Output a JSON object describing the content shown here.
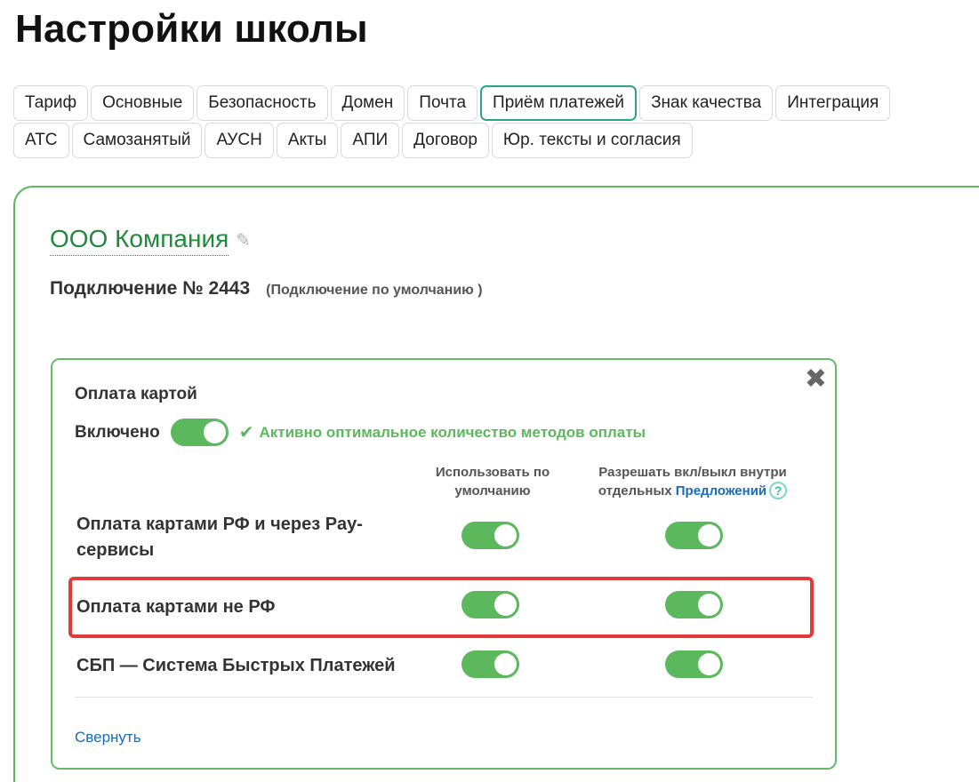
{
  "page_title": "Настройки школы",
  "tabs_row1": [
    "Тариф",
    "Основные",
    "Безопасность",
    "Домен",
    "Почта",
    "Приём платежей",
    "Знак качества",
    "Интеграция"
  ],
  "tabs_row2": [
    "АТС",
    "Самозанятый",
    "АУСН",
    "Акты",
    "АПИ",
    "Договор",
    "Юр. тексты и согласия"
  ],
  "active_tab": "Приём платежей",
  "company": {
    "name": "ООО Компания",
    "edit_icon": "pencil-icon"
  },
  "connection": {
    "title": "Подключение № 2443",
    "note": "(Подключение по умолчанию )"
  },
  "card": {
    "title": "Оплата картой",
    "enabled_label": "Включено",
    "enabled": true,
    "status_icon": "check-icon",
    "status_message": "Активно оптимальное количество методов оплаты",
    "close_icon": "close-icon",
    "columns": {
      "default_line1": "Использовать по",
      "default_line2": "умолчанию",
      "allow_line1": "Разрешать вкл/выкл внутри",
      "allow_line2_prefix": "отдельных",
      "allow_link": "Предложений",
      "help": "?"
    },
    "methods": [
      {
        "line1": "Оплата картами РФ и через Pay-",
        "line2": "сервисы",
        "use_default": true,
        "allow_in_offers": true
      },
      {
        "label": "Оплата картами не РФ",
        "use_default": true,
        "allow_in_offers": true,
        "highlighted": true
      },
      {
        "label": "СБП — Система Быстрых Платежей",
        "use_default": true,
        "allow_in_offers": true
      }
    ],
    "collapse_label": "Свернуть"
  },
  "colors": {
    "accent_green": "#5cb85c",
    "active_tab_border": "#2ba58a",
    "link_blue": "#1a6bb8",
    "highlight_red": "#e13a3a"
  }
}
